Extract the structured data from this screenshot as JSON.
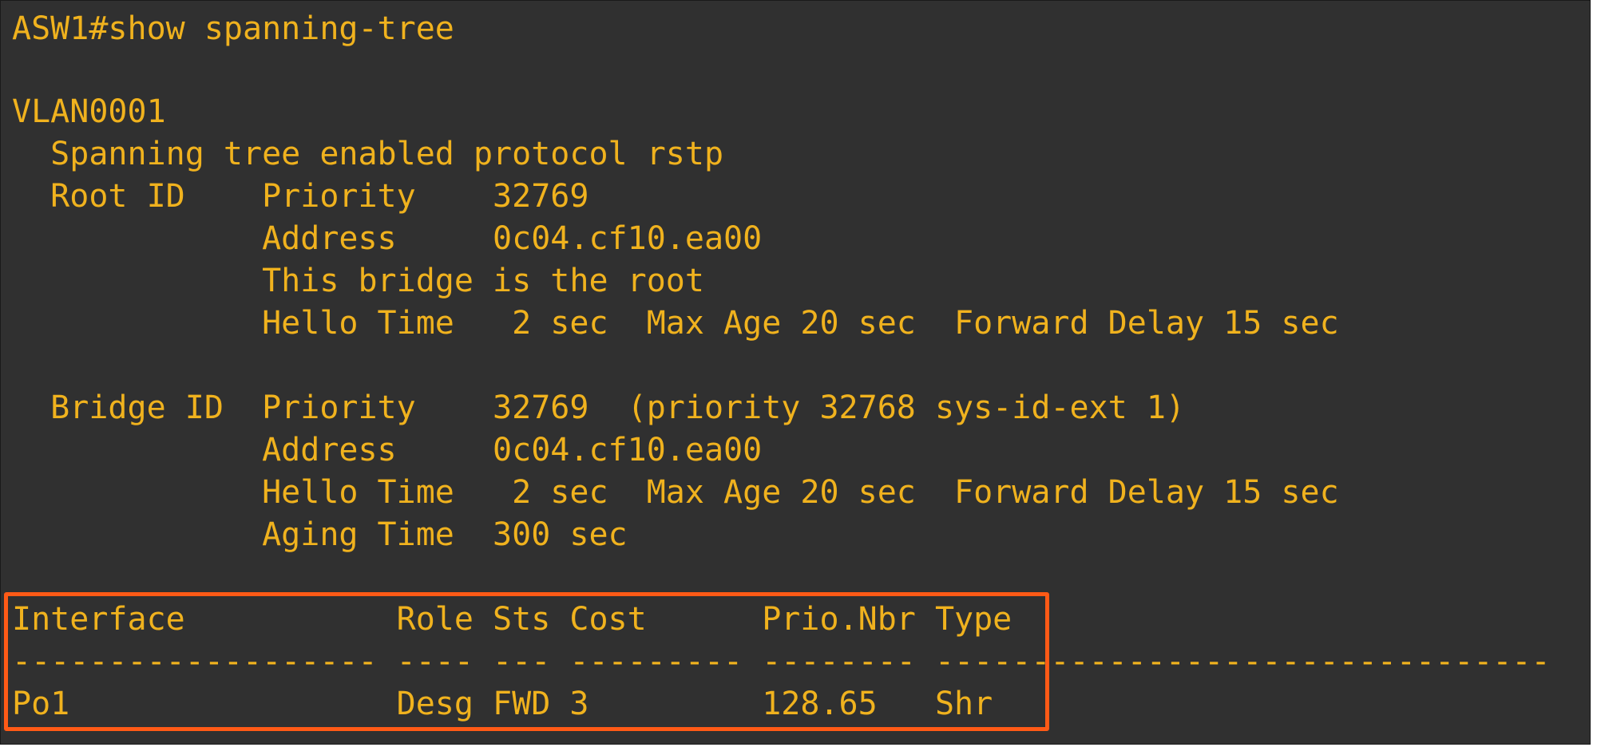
{
  "terminal": {
    "command_line": "ASW1#show spanning-tree",
    "vlan": "VLAN0001",
    "protocol_line": "  Spanning tree enabled protocol rstp",
    "root_priority": "  Root ID    Priority    32769",
    "root_address": "             Address     0c04.cf10.ea00",
    "root_note": "             This bridge is the root",
    "root_timers": "             Hello Time   2 sec  Max Age 20 sec  Forward Delay 15 sec",
    "bridge_priority": "  Bridge ID  Priority    32769  (priority 32768 sys-id-ext 1)",
    "bridge_address": "             Address     0c04.cf10.ea00",
    "bridge_timers": "             Hello Time   2 sec  Max Age 20 sec  Forward Delay 15 sec",
    "bridge_aging": "             Aging Time  300 sec",
    "table_header": "Interface           Role Sts Cost      Prio.Nbr Type",
    "table_separator": "------------------- ---- --- --------- -------- --------------------------------",
    "table_row": "Po1                 Desg FWD 3         128.65   Shr"
  },
  "colors": {
    "background": "#303030",
    "text": "#f0b21e",
    "highlight": "#ff5a16"
  }
}
